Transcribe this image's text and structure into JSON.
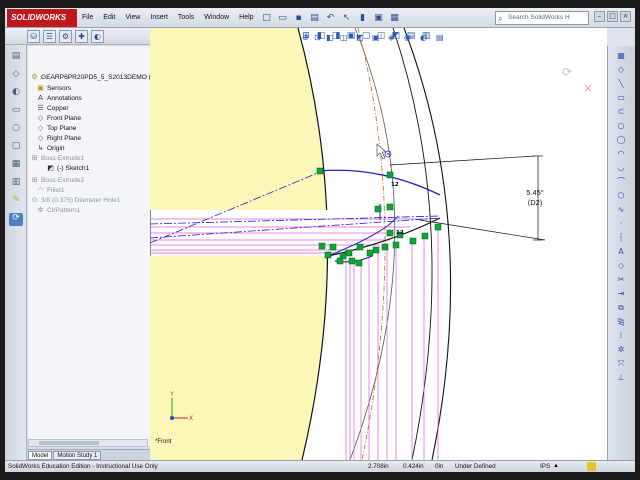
{
  "app": {
    "logo": "SOLIDWORKS",
    "menus": [
      "File",
      "Edit",
      "View",
      "Insert",
      "Tools",
      "Window",
      "Help"
    ],
    "search_placeholder": "Search SolidWorks H",
    "window_controls": [
      "minimize-icon",
      "restore-icon",
      "close-icon"
    ]
  },
  "feature_tree": {
    "root": "GEARP6PR20PD5_5_S2013DEMO  (",
    "items": [
      {
        "label": "Sensors",
        "icon": "sensor-icon"
      },
      {
        "label": "Annotations",
        "icon": "annotation-icon"
      },
      {
        "label": "Copper",
        "icon": "material-icon"
      },
      {
        "label": "Front Plane",
        "icon": "plane-icon"
      },
      {
        "label": "Top Plane",
        "icon": "plane-icon"
      },
      {
        "label": "Right Plane",
        "icon": "plane-icon"
      },
      {
        "label": "Origin",
        "icon": "origin-icon"
      },
      {
        "label": "Boss-Extrude1",
        "icon": "extrude-icon"
      },
      {
        "label": "(-) Sketch1",
        "icon": "sketch-icon"
      },
      {
        "label": "Boss-Extrude2",
        "icon": "extrude-icon"
      },
      {
        "label": "Fillet1",
        "icon": "fillet-icon"
      },
      {
        "label": "3/8 (0.375) Diameter Hole1",
        "icon": "hole-icon"
      },
      {
        "label": "CirPattern1",
        "icon": "pattern-icon"
      }
    ]
  },
  "bottom_tabs": [
    "Model",
    "Motion Study 1"
  ],
  "graphics": {
    "dimension_value": "5.45°",
    "dimension_name": "(D2)",
    "relation_tags": [
      "12",
      "12"
    ],
    "view_label": "*Front",
    "triad_axes": [
      "Y",
      "X"
    ]
  },
  "status_bar": {
    "edition": "SolidWorks Education Edition - Instructional Use Only",
    "x": "2.708in",
    "y": "0.424in",
    "z": "0in",
    "state": "Under Defined",
    "units": "IPS"
  },
  "colors": {
    "face_fill": "#fbf7b8",
    "sketch_blue": "#1f1fc8",
    "construction_pink": "#e05ad7",
    "relation_green": "#0fa534",
    "logo_red": "#c0161d"
  }
}
